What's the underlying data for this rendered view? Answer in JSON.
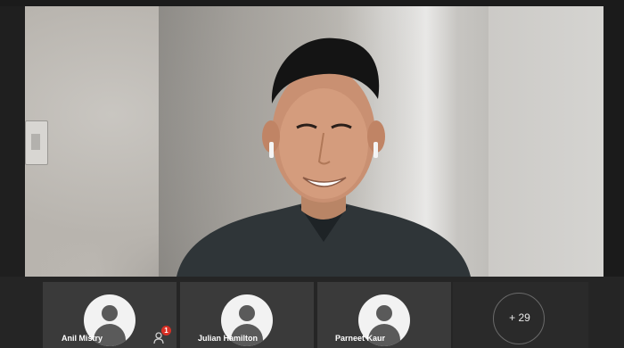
{
  "speaker": {
    "video_description": "main-speaker-feed"
  },
  "participants": [
    {
      "name": "Anil Mistry"
    },
    {
      "name": "Julian Hamilton"
    },
    {
      "name": "Parneet Kaur"
    }
  ],
  "raise_hand_count": "1",
  "overflow_label": "+ 29",
  "colors": {
    "background": "#1f1f1f",
    "tile": "#3a3a3a",
    "badge": "#d93025"
  }
}
